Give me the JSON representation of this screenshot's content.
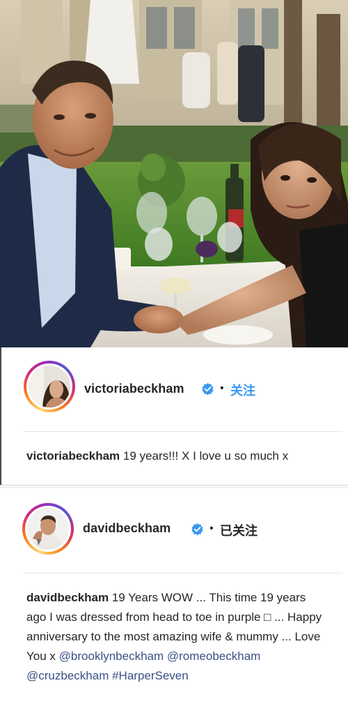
{
  "photo": {
    "description_icon": "photo-image"
  },
  "posts": [
    {
      "username": "victoriabeckham",
      "follow_label": "关注",
      "follow_color": "#3897f0",
      "separator": "•",
      "caption_user": "victoriabeckham",
      "caption_text": " 19 years!!! X I love u so much x",
      "mentions": []
    },
    {
      "username": "davidbeckham",
      "follow_label": "已关注",
      "follow_color": "#262626",
      "separator": "•",
      "caption_user": "davidbeckham",
      "caption_text": " 19 Years WOW ... This time 19 years ago I was dressed from head to toe in purple □ ... Happy anniversary to the most amazing wife & mummy ... Love You x",
      "mentions": [
        "@brooklynbeckham",
        "@romeobeckham",
        "@cruzbeckham",
        "#HarperSeven"
      ]
    }
  ],
  "colors": {
    "verified_blue": "#3897f0",
    "mention_blue": "#385185",
    "text": "#262626"
  }
}
